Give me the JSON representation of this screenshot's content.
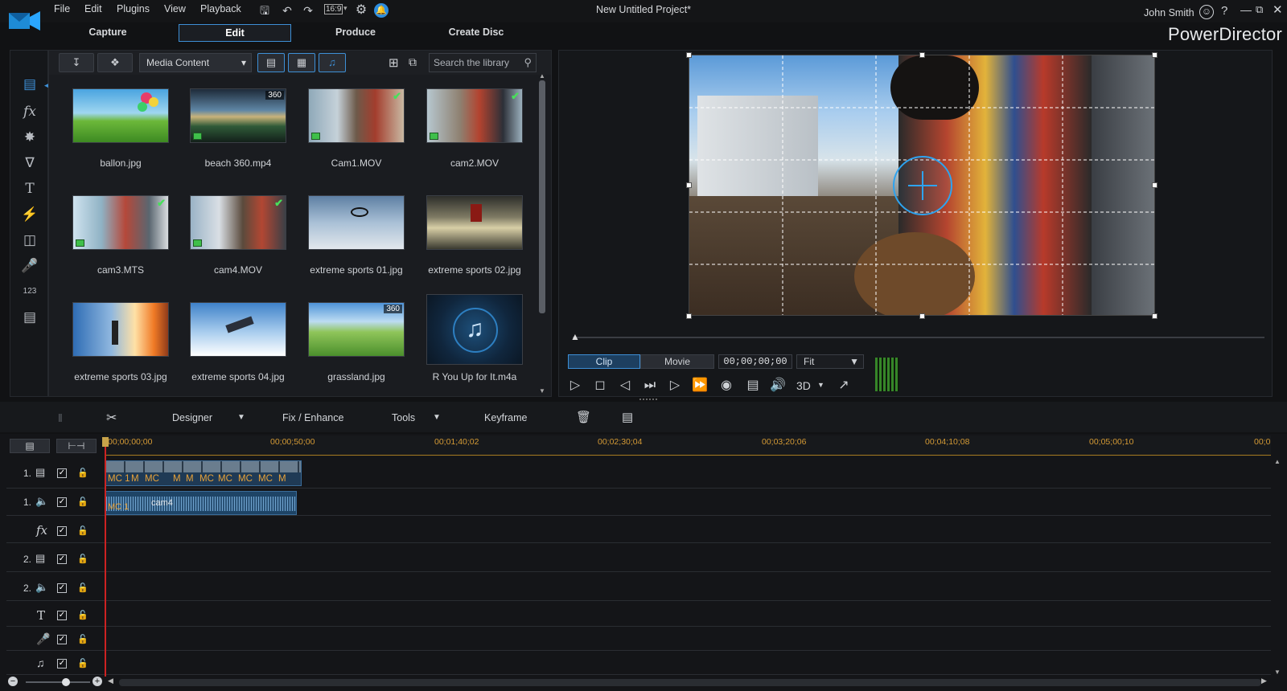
{
  "menu": [
    "File",
    "Edit",
    "Plugins",
    "View",
    "Playback"
  ],
  "aspect": "16:9",
  "project_title": "New Untitled Project*",
  "user": "John Smith",
  "brand": "PowerDirector",
  "modes": [
    "Capture",
    "Edit",
    "Produce",
    "Create Disc"
  ],
  "library": {
    "dropdown": "Media Content",
    "search_placeholder": "Search the library",
    "items": [
      {
        "name": "ballon.jpg"
      },
      {
        "name": "beach 360.mp4",
        "badge": "360"
      },
      {
        "name": "Cam1.MOV"
      },
      {
        "name": "cam2.MOV"
      },
      {
        "name": "cam3.MTS"
      },
      {
        "name": "cam4.MOV"
      },
      {
        "name": "extreme sports 01.jpg"
      },
      {
        "name": "extreme sports 02.jpg"
      },
      {
        "name": "extreme sports 03.jpg"
      },
      {
        "name": "extreme sports 04.jpg"
      },
      {
        "name": "grassland.jpg",
        "badge": "360"
      },
      {
        "name": "R You Up for It.m4a"
      }
    ]
  },
  "preview": {
    "clip_label": "Clip",
    "movie_label": "Movie",
    "timecode": "00;00;00;00",
    "fit": "Fit",
    "mode3d": "3D"
  },
  "toolbar": {
    "designer": "Designer",
    "fix": "Fix / Enhance",
    "tools": "Tools",
    "keyframe": "Keyframe"
  },
  "ruler": [
    "00;00;00;00",
    "00;00;50;00",
    "00;01;40;02",
    "00;02;30;04",
    "00;03;20;06",
    "00;04;10;08",
    "00;05;00;10",
    "00;0"
  ],
  "tracks": [
    "1.",
    "1.",
    "",
    "2.",
    "2.",
    "",
    "",
    ""
  ],
  "clips": {
    "video_labels": [
      "MC 1",
      "M",
      "MC",
      "M",
      "M",
      "MC",
      "MC",
      "MC",
      "MC",
      "M"
    ],
    "audio_labels": [
      "MC 1",
      "cam4"
    ]
  },
  "colors": {
    "accent": "#3d8fd6",
    "playhead": "#cc2222",
    "ruler_text": "#d49a35",
    "check": "#48e05a"
  }
}
